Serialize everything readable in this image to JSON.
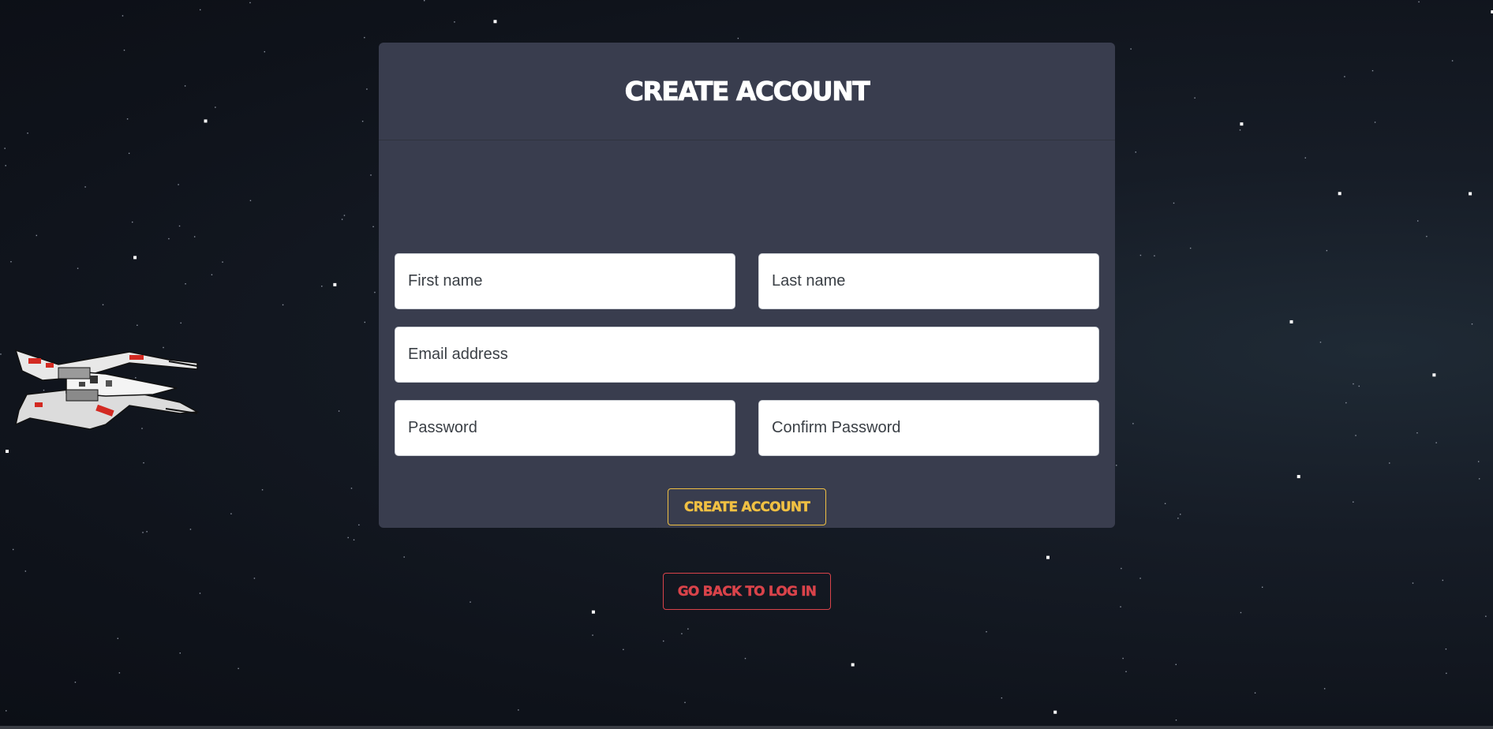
{
  "page": {
    "title": "CREATE ACCOUNT"
  },
  "form": {
    "first_name": {
      "placeholder": "First name",
      "value": ""
    },
    "last_name": {
      "placeholder": "Last name",
      "value": ""
    },
    "email": {
      "placeholder": "Email address",
      "value": ""
    },
    "password": {
      "placeholder": "Password",
      "value": ""
    },
    "confirm_password": {
      "placeholder": "Confirm Password",
      "value": ""
    }
  },
  "buttons": {
    "create_account": "CREATE ACCOUNT",
    "back_to_login": "GO BACK TO LOG IN"
  },
  "decor": {
    "ship_icon": "x-wing-starfighter-icon",
    "background": "starfield"
  },
  "colors": {
    "card_bg": "#393d4e",
    "accent_yellow": "#f0c043",
    "accent_red": "#d9434a"
  }
}
